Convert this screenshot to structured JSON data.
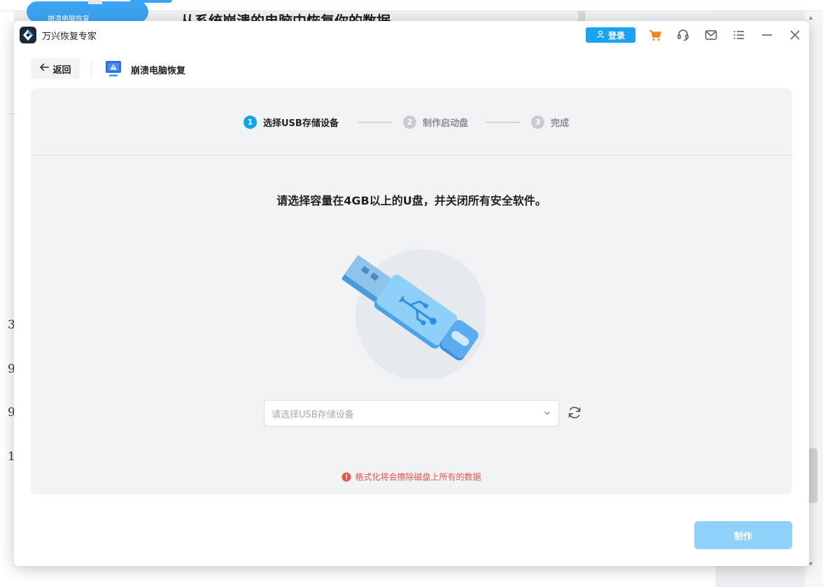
{
  "background": {
    "sidebar_pill_label": "崩溃电脑恢复",
    "heading": "从系统崩溃的电脑中恢复你的数据",
    "left_numbers": [
      "3",
      "9",
      "9",
      "1"
    ]
  },
  "window": {
    "app_title": "万兴恢复专家",
    "login_label": "登录",
    "toolbar_icons": [
      "cart-icon",
      "headset-icon",
      "mail-icon",
      "menu-icon",
      "minimize-icon",
      "close-icon"
    ]
  },
  "nav": {
    "back_label": "返回",
    "page_title": "崩溃电脑恢复"
  },
  "steps": [
    {
      "number": "1",
      "label": "选择USB存储设备",
      "state": "active"
    },
    {
      "number": "2",
      "label": "制作启动盘",
      "state": "inactive"
    },
    {
      "number": "3",
      "label": "完成",
      "state": "inactive"
    }
  ],
  "main": {
    "instruction": "请选择容量在4GB以上的U盘，并关闭所有安全软件。",
    "select_placeholder": "请选择USB存储设备",
    "warning": "格式化将会擦除磁盘上所有的数据"
  },
  "footer": {
    "make_label": "制作"
  },
  "colors": {
    "accent": "#14a3f2",
    "button_disabled": "#8ed2fa",
    "warning": "#e8534a",
    "panel_bg": "#f2f3f5"
  }
}
